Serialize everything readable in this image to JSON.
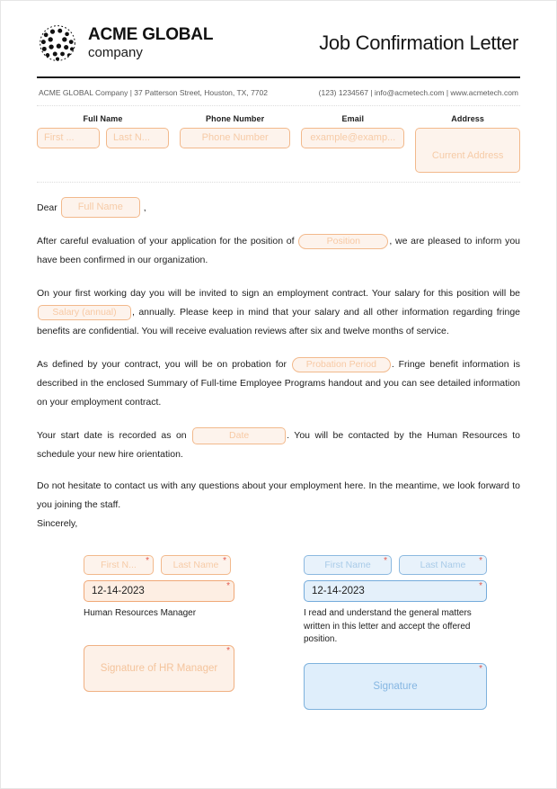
{
  "header": {
    "brand_name": "ACME GLOBAL",
    "brand_sub": "company",
    "doc_title": "Job Confirmation Letter",
    "logo_icon": "globe-dots-icon"
  },
  "contact": {
    "left": "ACME GLOBAL Company | 37 Patterson Street, Houston, TX, 7702",
    "right": "(123) 1234567 | info@acmetech.com | www.acmetech.com"
  },
  "fields": {
    "full_name_label": "Full Name",
    "first_name_placeholder": "First ...",
    "last_name_placeholder": "Last N...",
    "phone_label": "Phone Number",
    "phone_placeholder": "Phone Number",
    "email_label": "Email",
    "email_placeholder": "example@examp...",
    "address_label": "Address",
    "address_placeholder": "Current Address"
  },
  "letter": {
    "dear_label": "Dear",
    "dear_placeholder": "Full Name",
    "dear_comma": ",",
    "p1_before": "After careful evaluation of your application for the position of",
    "position_placeholder": "Position",
    "p1_after": ", we are pleased to inform you have been confirmed in our organization.",
    "p2_before": "On your first working day you will be invited to sign an employment contract. Your salary for this position will be",
    "salary_placeholder": "Salary (annual)",
    "p2_after": ", annually. Please keep in mind that your salary and all other information regarding fringe benefits are confidential. You will receive evaluation reviews after six and twelve months of service.",
    "p3_before": "As defined by your contract, you will be on probation for",
    "probation_placeholder": "Probation Period",
    "p3_after": ". Fringe benefit information is described in the enclosed Summary of Full-time Employee Programs handout and you can see detailed information on your employment contract.",
    "p4_before": "Your start date is recorded as on",
    "date_placeholder": "Date",
    "p4_after": ". You will be contacted by the Human Resources to schedule your new hire orientation.",
    "p5": "Do not hesitate to contact us with any questions about your employment here. In the meantime, we look forward to you joining the staff.",
    "sincerely": "Sincerely,"
  },
  "signature": {
    "hr": {
      "first_name_placeholder": "First N...",
      "last_name_placeholder": "Last Name",
      "date_value": "12-14-2023",
      "caption": "Human Resources Manager",
      "signature_placeholder": "Signature of HR Manager"
    },
    "employee": {
      "first_name_placeholder": "First Name",
      "last_name_placeholder": "Last Name",
      "date_value": "12-14-2023",
      "caption": "I read and understand the general matters written in this letter and accept the offered position.",
      "signature_placeholder": "Signature"
    }
  },
  "colors": {
    "accent_orange": "#f2b98c",
    "accent_blue": "#8cb9e0",
    "required_red": "#e2574c",
    "text": "#1d1d1d"
  }
}
